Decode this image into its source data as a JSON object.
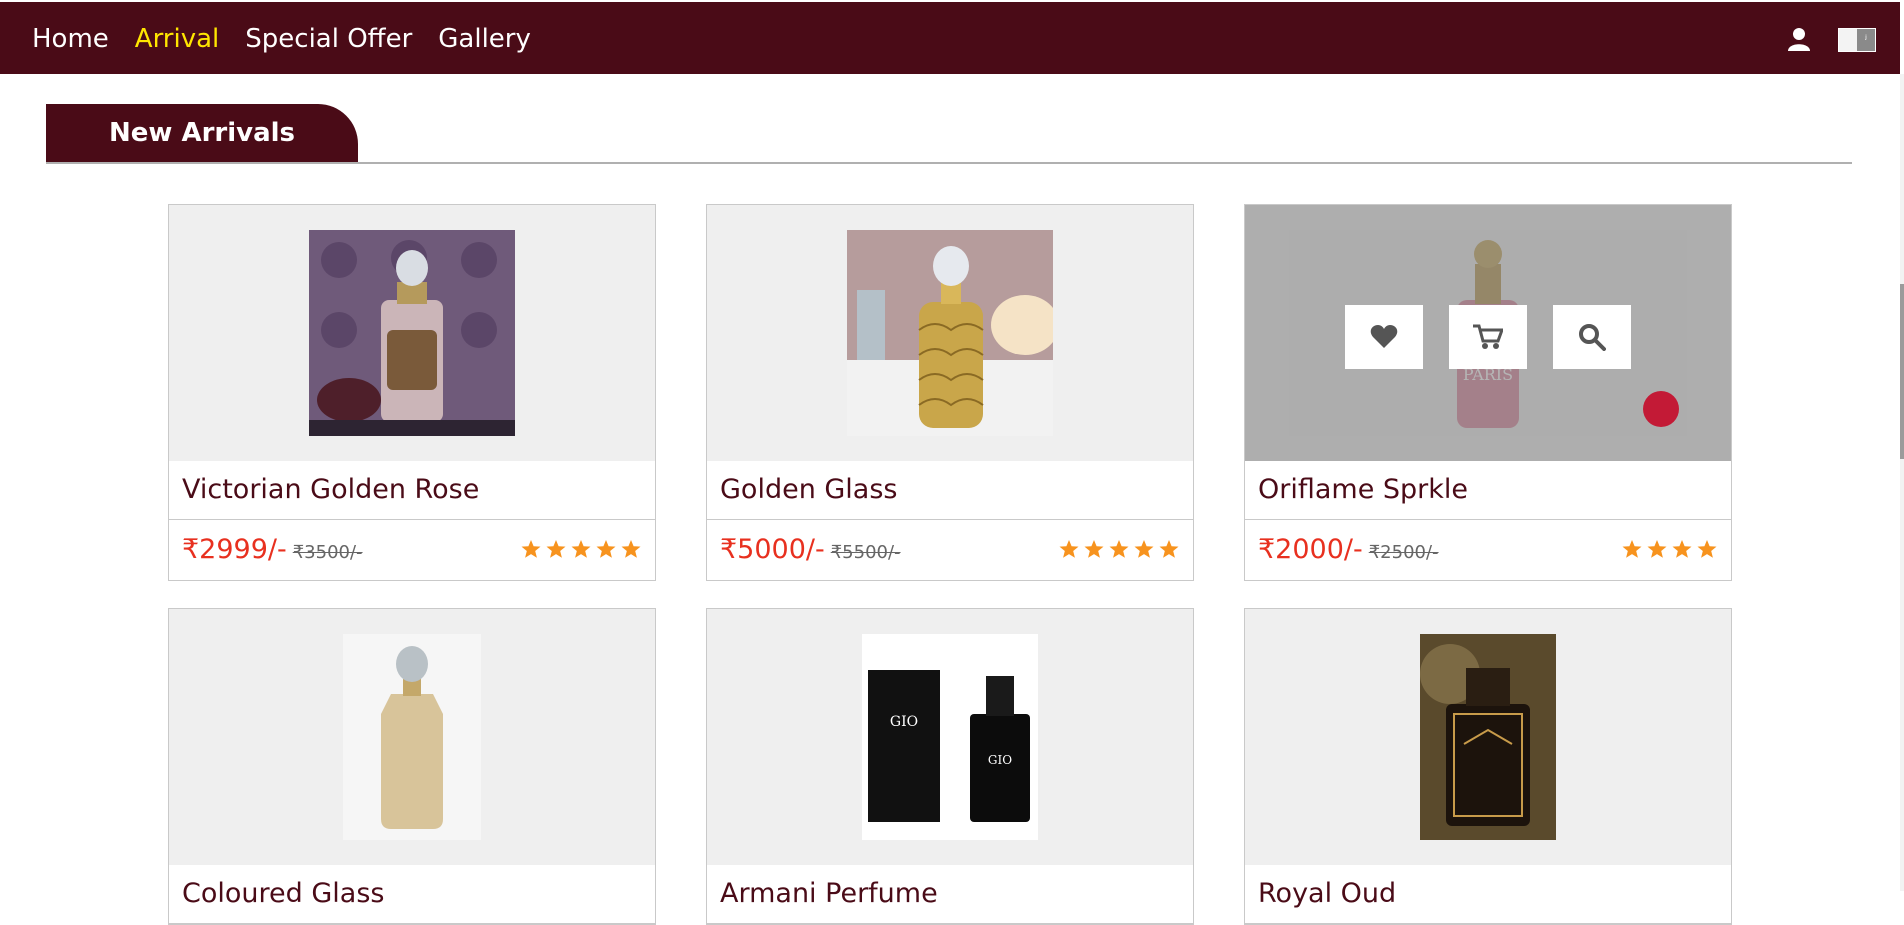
{
  "nav": {
    "items": [
      {
        "label": "Home",
        "active": false
      },
      {
        "label": "Arrival",
        "active": true
      },
      {
        "label": "Special Offer",
        "active": false
      },
      {
        "label": "Gallery",
        "active": false
      }
    ],
    "user_icon": "user-icon",
    "language_toggle_icon": "language-toggle-icon"
  },
  "section": {
    "title": "New Arrivals"
  },
  "products": [
    {
      "name": "Victorian Golden Rose",
      "price": "₹2999/-",
      "old_price": "₹3500/-",
      "rating": 5,
      "hovered": false
    },
    {
      "name": "Golden Glass",
      "price": "₹5000/-",
      "old_price": "₹5500/-",
      "rating": 5,
      "hovered": false
    },
    {
      "name": "Oriflame Sprkle",
      "price": "₹2000/-",
      "old_price": "₹2500/-",
      "rating": 4,
      "hovered": true,
      "actions": [
        "heart-icon",
        "cart-icon",
        "search-icon"
      ]
    },
    {
      "name": "Coloured Glass",
      "price": "",
      "old_price": "",
      "rating": 0,
      "hovered": false
    },
    {
      "name": "Armani Perfume",
      "price": "",
      "old_price": "",
      "rating": 0,
      "hovered": false
    },
    {
      "name": "Royal Oud",
      "price": "",
      "old_price": "",
      "rating": 0,
      "hovered": false
    }
  ],
  "colors": {
    "brand": "#4a0b17",
    "active_nav": "#ffe600",
    "price": "#e8301f",
    "star": "#f7931e"
  }
}
